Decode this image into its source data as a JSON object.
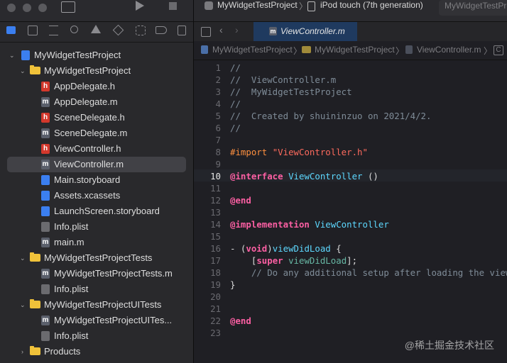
{
  "window": {
    "breadcrumb_project": "MyWidgetTestProject",
    "breadcrumb_device": "iPod touch (7th generation)",
    "breadcrumb_trail": "MyWidgetTestProj"
  },
  "tab": {
    "label": "ViewController.m"
  },
  "jumpbar": {
    "items": [
      "MyWidgetTestProject",
      "MyWidgetTestProject",
      "ViewController.m"
    ]
  },
  "navigator": {
    "root": "MyWidgetTestProject",
    "group1": "MyWidgetTestProject",
    "files1": [
      {
        "label": "AppDelegate.h",
        "badge": "h",
        "color": "#d4382c"
      },
      {
        "label": "AppDelegate.m",
        "badge": "m",
        "color": "#5a5f6b"
      },
      {
        "label": "SceneDelegate.h",
        "badge": "h",
        "color": "#d4382c"
      },
      {
        "label": "SceneDelegate.m",
        "badge": "m",
        "color": "#5a5f6b"
      },
      {
        "label": "ViewController.h",
        "badge": "h",
        "color": "#d4382c"
      },
      {
        "label": "ViewController.m",
        "badge": "m",
        "color": "#5a5f6b"
      },
      {
        "label": "Main.storyboard",
        "badge": "",
        "color": "#3b7ff0"
      },
      {
        "label": "Assets.xcassets",
        "badge": "",
        "color": "#3b7ff0"
      },
      {
        "label": "LaunchScreen.storyboard",
        "badge": "",
        "color": "#3b7ff0"
      },
      {
        "label": "Info.plist",
        "badge": "",
        "color": "#6b6b6f"
      },
      {
        "label": "main.m",
        "badge": "m",
        "color": "#5a5f6b"
      }
    ],
    "group2": "MyWidgetTestProjectTests",
    "files2": [
      {
        "label": "MyWidgetTestProjectTests.m",
        "badge": "m",
        "color": "#5a5f6b"
      },
      {
        "label": "Info.plist",
        "badge": "",
        "color": "#6b6b6f"
      }
    ],
    "group3": "MyWidgetTestProjectUITests",
    "files3": [
      {
        "label": "MyWidgetTestProjectUITes...",
        "badge": "m",
        "color": "#5a5f6b"
      },
      {
        "label": "Info.plist",
        "badge": "",
        "color": "#6b6b6f"
      }
    ],
    "group4": "Products"
  },
  "code": {
    "lines": [
      {
        "n": "1",
        "html": "<span class='cmt'>//</span>"
      },
      {
        "n": "2",
        "html": "<span class='cmt'>//  ViewController.m</span>"
      },
      {
        "n": "3",
        "html": "<span class='cmt'>//  MyWidgetTestProject</span>"
      },
      {
        "n": "4",
        "html": "<span class='cmt'>//</span>"
      },
      {
        "n": "5",
        "html": "<span class='cmt'>//  Created by shuininzuo on 2021/4/2.</span>"
      },
      {
        "n": "6",
        "html": "<span class='cmt'>//</span>"
      },
      {
        "n": "7",
        "html": ""
      },
      {
        "n": "8",
        "html": "<span class='pp'>#import </span><span class='str'>\"ViewController.h\"</span>"
      },
      {
        "n": "9",
        "html": ""
      },
      {
        "n": "10",
        "html": "<span class='kw'>@interface</span> <span class='cls'>ViewController</span> ()"
      },
      {
        "n": "11",
        "html": ""
      },
      {
        "n": "12",
        "html": "<span class='kw'>@end</span>"
      },
      {
        "n": "13",
        "html": ""
      },
      {
        "n": "14",
        "html": "<span class='kw'>@implementation</span> <span class='cls'>ViewController</span>"
      },
      {
        "n": "15",
        "html": ""
      },
      {
        "n": "16",
        "html": "- (<span class='kw'>void</span>)<span class='cls'>viewDidLoad</span> {"
      },
      {
        "n": "17",
        "html": "    [<span class='kw'>super</span> <span class='mth'>viewDidLoad</span>];"
      },
      {
        "n": "18",
        "html": "    <span class='cmt'>// Do any additional setup after loading the view.</span>"
      },
      {
        "n": "19",
        "html": "}"
      },
      {
        "n": "20",
        "html": ""
      },
      {
        "n": "21",
        "html": ""
      },
      {
        "n": "22",
        "html": "<span class='kw'>@end</span>"
      },
      {
        "n": "23",
        "html": ""
      }
    ]
  },
  "watermark": "@稀土掘金技术社区"
}
